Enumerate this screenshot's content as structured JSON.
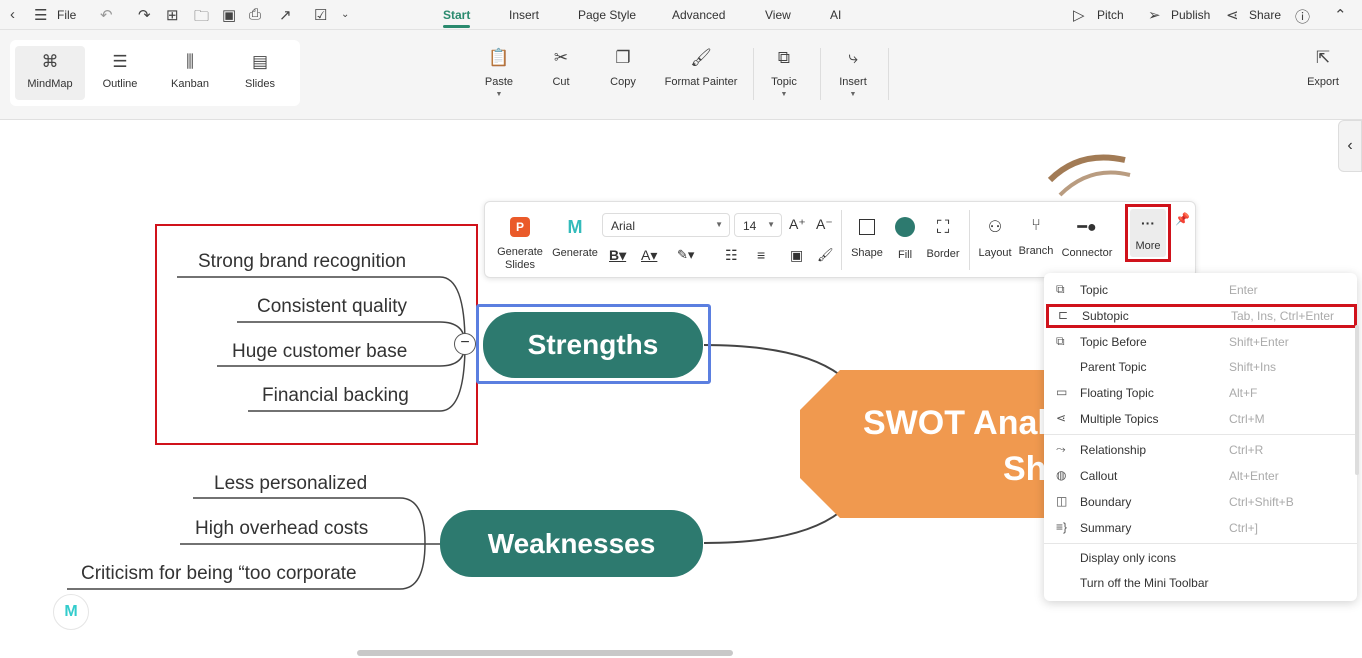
{
  "topbar": {
    "file": "File",
    "tabs": [
      "Start",
      "Insert",
      "Page Style",
      "Advanced",
      "View",
      "AI"
    ],
    "pitch": "Pitch",
    "publish": "Publish",
    "share": "Share"
  },
  "views": [
    "MindMap",
    "Outline",
    "Kanban",
    "Slides"
  ],
  "ribbon": {
    "paste": "Paste",
    "cut": "Cut",
    "copy": "Copy",
    "format_painter": "Format Painter",
    "topic": "Topic",
    "insert": "Insert",
    "export": "Export"
  },
  "mini_toolbar": {
    "generate_slides": "Generate Slides",
    "generate": "Generate",
    "font": "Arial",
    "size": "14",
    "shape": "Shape",
    "fill": "Fill",
    "border": "Border",
    "layout": "Layout",
    "branch": "Branch",
    "connector": "Connector",
    "more": "More",
    "fill_color": "#2d7a6f"
  },
  "map": {
    "central": "SWOT Analysis",
    "central_line2": "Sh",
    "strengths": {
      "label": "Strengths",
      "items": [
        "Strong brand recognition",
        "Consistent quality",
        "Huge customer base",
        "Financial backing"
      ]
    },
    "weaknesses": {
      "label": "Weaknesses",
      "items": [
        "Less personalized",
        "High overhead costs",
        "Criticism for being “too corporate"
      ]
    }
  },
  "menu": {
    "groups": [
      [
        {
          "icon": "topic-icon",
          "label": "Topic",
          "shortcut": "Enter"
        },
        {
          "icon": "subtopic-icon",
          "label": "Subtopic",
          "shortcut": "Tab, Ins, Ctrl+Enter"
        },
        {
          "icon": "topic-before-icon",
          "label": "Topic Before",
          "shortcut": "Shift+Enter"
        },
        {
          "icon": "",
          "label": "Parent Topic",
          "shortcut": "Shift+Ins"
        },
        {
          "icon": "floating-topic-icon",
          "label": "Floating Topic",
          "shortcut": "Alt+F"
        },
        {
          "icon": "multiple-topics-icon",
          "label": "Multiple Topics",
          "shortcut": "Ctrl+M"
        }
      ],
      [
        {
          "icon": "relationship-icon",
          "label": "Relationship",
          "shortcut": "Ctrl+R"
        },
        {
          "icon": "callout-icon",
          "label": "Callout",
          "shortcut": "Alt+Enter"
        },
        {
          "icon": "boundary-icon",
          "label": "Boundary",
          "shortcut": "Ctrl+Shift+B"
        },
        {
          "icon": "summary-icon",
          "label": "Summary",
          "shortcut": "Ctrl+]"
        }
      ],
      [
        {
          "icon": "",
          "label": "Display only icons",
          "shortcut": ""
        },
        {
          "icon": "",
          "label": "Turn off the Mini Toolbar",
          "shortcut": ""
        }
      ]
    ]
  },
  "colors": {
    "accent": "#2a8a6e",
    "node": "#2d7a6f",
    "central": "#f0994f",
    "highlight": "#d0121b",
    "selection": "#5b7fe0"
  }
}
